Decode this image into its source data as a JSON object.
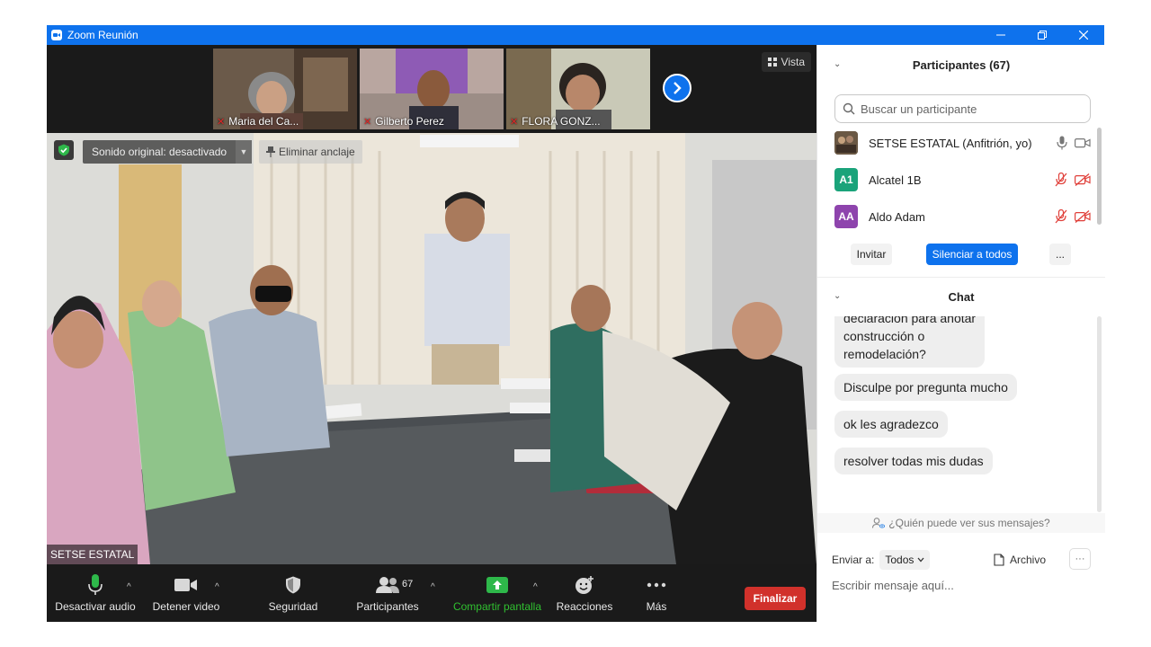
{
  "window": {
    "title": "Zoom Reunión"
  },
  "video": {
    "view_label": "Vista",
    "sound_label": "Sonido original: desactivado",
    "unpin_label": "Eliminar anclaje",
    "speaker_name": "SETSE ESTATAL",
    "thumbnails": [
      {
        "name": "Maria del Ca...",
        "muted": true
      },
      {
        "name": "Gilberto Perez",
        "muted": true
      },
      {
        "name": "FLORA GONZ...",
        "muted": true
      }
    ]
  },
  "toolbar": {
    "mute_label": "Desactivar audio",
    "video_label": "Detener video",
    "security_label": "Seguridad",
    "participants_label": "Participantes",
    "participants_count": "67",
    "share_label": "Compartir pantalla",
    "reactions_label": "Reacciones",
    "more_label": "Más",
    "end_label": "Finalizar"
  },
  "participants": {
    "header": "Participantes (67)",
    "search_placeholder": "Buscar un participante",
    "list": [
      {
        "name": "SETSE ESTATAL (Anfitrión, yo)",
        "initials": "",
        "color": "#5b4a3a",
        "muted": false,
        "video_off": false
      },
      {
        "name": "Alcatel 1B",
        "initials": "A1",
        "color": "#1aa37a",
        "muted": true,
        "video_off": true
      },
      {
        "name": "Aldo Adam",
        "initials": "AA",
        "color": "#8e44ad",
        "muted": true,
        "video_off": true
      }
    ],
    "invite_label": "Invitar",
    "mute_all_label": "Silenciar a todos",
    "more_label": "..."
  },
  "chat": {
    "header": "Chat",
    "messages": [
      "declaración para anotar\nconstrucción o\nremodelación?",
      "Disculpe por pregunta mucho",
      "ok les agradezco",
      "resolver todas mis dudas"
    ],
    "who_sees": "¿Quién puede ver sus mensajes?",
    "send_to_label": "Enviar a:",
    "send_to_value": "Todos",
    "file_label": "Archivo",
    "more_label": "···",
    "input_placeholder": "Escribir mensaje aquí..."
  },
  "colors": {
    "accent": "#0e72ed",
    "end": "#d1312b",
    "share": "#30c030"
  }
}
